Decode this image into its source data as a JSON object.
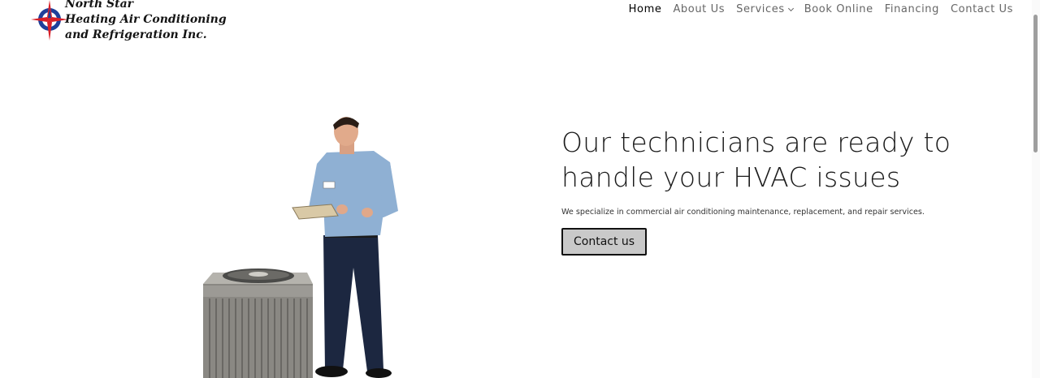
{
  "logo": {
    "line1": "North Star",
    "line2": "Heating Air Conditioning",
    "line3": "and Refrigeration Inc.",
    "icon": "compass-star-icon"
  },
  "nav": {
    "items": [
      {
        "label": "Home",
        "active": true
      },
      {
        "label": "About Us"
      },
      {
        "label": "Services",
        "has_dropdown": true
      },
      {
        "label": "Book Online"
      },
      {
        "label": "Financing"
      },
      {
        "label": "Contact Us"
      }
    ]
  },
  "hero": {
    "headline": "Our technicians are ready to handle your HVAC issues",
    "subtext": "We specialize in commercial air conditioning maintenance, replacement, and repair services.",
    "cta_label": "Contact us"
  },
  "colors": {
    "nav_active": "#000000",
    "nav_inactive": "#666666",
    "cta_background": "#c9c9c9",
    "cta_border": "#111111",
    "logo_red": "#d92028",
    "logo_blue": "#1f3f9a"
  }
}
